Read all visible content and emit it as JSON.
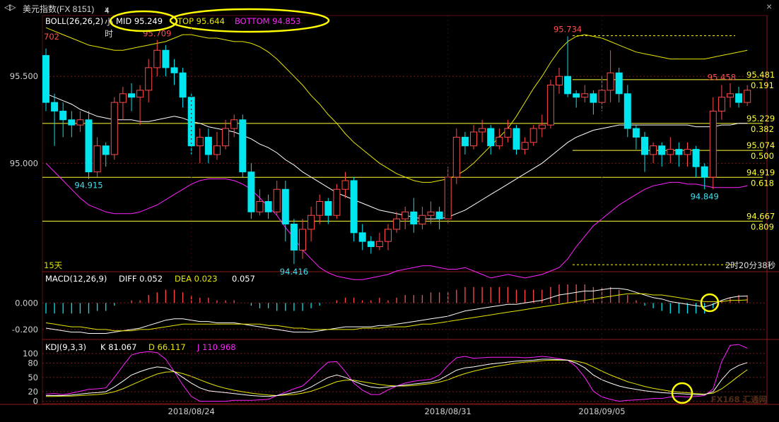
{
  "window": {
    "nav_icon": "back-forward-icon",
    "symbol": "美元指数(FX 8151)",
    "period": "4小时",
    "period_dropdown_icon": "chevron-down-icon"
  },
  "colors": {
    "up": "#ff4a4a",
    "down": "#00e5ee",
    "mid": "#ffffff",
    "top": "#e6e600",
    "bottom": "#ff22ff",
    "fib": "#ffff33",
    "grid": "#7a1a1a",
    "axis_text": "#d0d0d0",
    "highlight": "#ffff00"
  },
  "boll": {
    "label": "BOLL(26,26,2)",
    "mid_label": "MID 95.249",
    "top_label": "TOP 95.644",
    "bottom_label": "BOTTOM 94.853"
  },
  "main_chart": {
    "ylim": [
      94.38,
      95.85
    ],
    "y_ticks": [
      95.5,
      95.0
    ],
    "y_tick_labels": [
      "95.500",
      "95.000"
    ],
    "left_edge_label": "702",
    "period_label": "15天",
    "countdown": "2时20分38秒",
    "high_low_annotations": [
      {
        "text": "95.709",
        "index": 13,
        "value": 95.709,
        "kind": "high"
      },
      {
        "text": "94.915",
        "index": 5,
        "value": 94.915,
        "kind": "low"
      },
      {
        "text": "94.416",
        "index": 29,
        "value": 94.416,
        "kind": "low"
      },
      {
        "text": "95.734",
        "index": 61,
        "value": 95.734,
        "kind": "high"
      },
      {
        "text": "95.458",
        "index": 79,
        "value": 95.458,
        "kind": "high"
      },
      {
        "text": "94.849",
        "index": 77,
        "value": 94.849,
        "kind": "low"
      }
    ],
    "fib_levels": [
      {
        "price": 95.734,
        "label": "",
        "ratio": "",
        "dashed": true
      },
      {
        "price": 95.481,
        "label": "95.481",
        "ratio": "0.191",
        "dashed": false
      },
      {
        "price": 95.229,
        "label": "95.229",
        "ratio": "0.382",
        "dashed": false
      },
      {
        "price": 95.074,
        "label": "95.074",
        "ratio": "0.500",
        "dashed": false
      },
      {
        "price": 94.919,
        "label": "94.919",
        "ratio": "0.618",
        "dashed": false
      },
      {
        "price": 94.667,
        "label": "94.667",
        "ratio": "0.809",
        "dashed": false
      },
      {
        "price": 94.416,
        "label": "",
        "ratio": "",
        "dashed": true
      }
    ]
  },
  "macd": {
    "label": "MACD(12,26,9)",
    "diff_label": "DIFF 0.052",
    "dea_label": "DEA 0.023",
    "macd_value": "0.057",
    "ylim": [
      -0.27,
      0.22
    ],
    "y_ticks": [
      0.0,
      -0.2
    ],
    "y_tick_labels": [
      "0.000",
      "-0.200"
    ]
  },
  "kdj": {
    "label": "KDJ(9,3,3)",
    "k_label": "K 81.067",
    "d_label": "D 66.117",
    "j_label": "J 110.968",
    "ylim": [
      -5,
      125
    ],
    "y_ticks": [
      100,
      80,
      50,
      20,
      0
    ],
    "y_tick_labels": [
      "100",
      "80",
      "50",
      "20",
      "0"
    ]
  },
  "x_axis": {
    "labels": [
      {
        "text": "2018/08/24",
        "index": 17
      },
      {
        "text": "2018/08/31",
        "index": 47
      },
      {
        "text": "2018/09/05",
        "index": 65
      }
    ]
  },
  "watermark": "FX168 汇通网",
  "chart_data": {
    "type": "candlestick",
    "title": "美元指数(FX 8151)",
    "period": "4小时",
    "xlabel": "",
    "ylabel": "",
    "candles": [
      [
        95.62,
        95.35,
        95.66,
        95.3
      ],
      [
        95.35,
        95.3,
        95.4,
        95.1
      ],
      [
        95.3,
        95.25,
        95.35,
        95.15
      ],
      [
        95.25,
        95.22,
        95.3,
        95.15
      ],
      [
        95.22,
        95.25,
        95.3,
        95.18
      ],
      [
        95.25,
        94.95,
        95.3,
        94.91
      ],
      [
        94.95,
        95.1,
        95.15,
        94.92
      ],
      [
        95.1,
        95.05,
        95.12,
        94.98
      ],
      [
        95.05,
        95.35,
        95.38,
        95.02
      ],
      [
        95.35,
        95.4,
        95.44,
        95.25
      ],
      [
        95.4,
        95.38,
        95.46,
        95.3
      ],
      [
        95.38,
        95.42,
        95.45,
        95.22
      ],
      [
        95.42,
        95.55,
        95.6,
        95.35
      ],
      [
        95.55,
        95.65,
        95.71,
        95.5
      ],
      [
        95.65,
        95.55,
        95.68,
        95.5
      ],
      [
        95.55,
        95.52,
        95.6,
        95.45
      ],
      [
        95.52,
        95.38,
        95.55,
        95.32
      ],
      [
        95.38,
        95.1,
        95.4,
        95.05
      ],
      [
        95.1,
        95.15,
        95.2,
        95.0
      ],
      [
        95.15,
        95.05,
        95.2,
        95.0
      ],
      [
        95.05,
        95.1,
        95.18,
        95.02
      ],
      [
        95.1,
        95.2,
        95.25,
        95.08
      ],
      [
        95.2,
        95.25,
        95.28,
        95.15
      ],
      [
        95.25,
        94.95,
        95.28,
        94.92
      ],
      [
        94.95,
        94.72,
        95.0,
        94.68
      ],
      [
        94.72,
        94.78,
        94.85,
        94.7
      ],
      [
        94.78,
        94.72,
        94.82,
        94.68
      ],
      [
        94.72,
        94.85,
        94.9,
        94.7
      ],
      [
        94.85,
        94.65,
        94.9,
        94.55
      ],
      [
        94.65,
        94.5,
        94.68,
        94.42
      ],
      [
        94.5,
        94.62,
        94.68,
        94.45
      ],
      [
        94.62,
        94.7,
        94.75,
        94.55
      ],
      [
        94.7,
        94.78,
        94.82,
        94.65
      ],
      [
        94.78,
        94.7,
        94.8,
        94.65
      ],
      [
        94.7,
        94.85,
        94.88,
        94.68
      ],
      [
        94.85,
        94.9,
        94.95,
        94.8
      ],
      [
        94.9,
        94.6,
        94.92,
        94.55
      ],
      [
        94.6,
        94.55,
        94.65,
        94.5
      ],
      [
        94.55,
        94.52,
        94.58,
        94.48
      ],
      [
        94.52,
        94.55,
        94.6,
        94.5
      ],
      [
        94.55,
        94.62,
        94.65,
        94.5
      ],
      [
        94.62,
        94.68,
        94.72,
        94.6
      ],
      [
        94.68,
        94.72,
        94.75,
        94.62
      ],
      [
        94.72,
        94.65,
        94.8,
        94.6
      ],
      [
        94.65,
        94.7,
        94.75,
        94.62
      ],
      [
        94.7,
        94.72,
        94.78,
        94.65
      ],
      [
        94.72,
        94.68,
        94.75,
        94.62
      ],
      [
        94.68,
        94.92,
        94.98,
        94.65
      ],
      [
        94.92,
        95.15,
        95.2,
        94.88
      ],
      [
        95.15,
        95.1,
        95.18,
        95.05
      ],
      [
        95.1,
        95.18,
        95.22,
        95.08
      ],
      [
        95.18,
        95.2,
        95.25,
        95.12
      ],
      [
        95.2,
        95.1,
        95.22,
        95.05
      ],
      [
        95.1,
        95.15,
        95.2,
        95.08
      ],
      [
        95.15,
        95.2,
        95.25,
        95.12
      ],
      [
        95.2,
        95.08,
        95.22,
        95.05
      ],
      [
        95.08,
        95.12,
        95.15,
        95.05
      ],
      [
        95.12,
        95.2,
        95.22,
        95.1
      ],
      [
        95.2,
        95.22,
        95.28,
        95.15
      ],
      [
        95.22,
        95.45,
        95.48,
        95.2
      ],
      [
        95.45,
        95.5,
        95.55,
        95.4
      ],
      [
        95.5,
        95.4,
        95.73,
        95.38
      ],
      [
        95.4,
        95.38,
        95.42,
        95.32
      ],
      [
        95.38,
        95.4,
        95.45,
        95.35
      ],
      [
        95.4,
        95.35,
        95.42,
        95.28
      ],
      [
        95.35,
        95.42,
        95.5,
        95.3
      ],
      [
        95.42,
        95.52,
        95.65,
        95.35
      ],
      [
        95.52,
        95.4,
        95.55,
        95.35
      ],
      [
        95.4,
        95.2,
        95.45,
        95.15
      ],
      [
        95.2,
        95.15,
        95.22,
        95.08
      ],
      [
        95.15,
        95.05,
        95.18,
        94.95
      ],
      [
        95.05,
        95.1,
        95.12,
        95.0
      ],
      [
        95.1,
        95.05,
        95.12,
        94.98
      ],
      [
        95.05,
        95.08,
        95.15,
        95.0
      ],
      [
        95.08,
        95.05,
        95.12,
        94.98
      ],
      [
        95.05,
        95.08,
        95.12,
        94.98
      ],
      [
        95.08,
        94.98,
        95.1,
        94.92
      ],
      [
        94.98,
        94.92,
        95.0,
        94.85
      ],
      [
        94.92,
        95.3,
        95.38,
        94.85
      ],
      [
        95.3,
        95.38,
        95.45,
        95.25
      ],
      [
        95.38,
        95.4,
        95.46,
        95.32
      ],
      [
        95.4,
        95.35,
        95.44,
        95.32
      ],
      [
        95.35,
        95.42,
        95.45,
        95.33
      ]
    ],
    "boll_mid": [
      95.4,
      95.38,
      95.36,
      95.34,
      95.31,
      95.29,
      95.27,
      95.26,
      95.25,
      95.25,
      95.25,
      95.24,
      95.24,
      95.25,
      95.26,
      95.27,
      95.26,
      95.24,
      95.23,
      95.21,
      95.2,
      95.19,
      95.18,
      95.16,
      95.14,
      95.11,
      95.09,
      95.06,
      95.02,
      94.99,
      94.95,
      94.92,
      94.89,
      94.86,
      94.83,
      94.81,
      94.79,
      94.77,
      94.75,
      94.73,
      94.72,
      94.71,
      94.7,
      94.69,
      94.68,
      94.68,
      94.68,
      94.69,
      94.71,
      94.73,
      94.76,
      94.79,
      94.82,
      94.85,
      94.88,
      94.91,
      94.94,
      94.97,
      95.0,
      95.04,
      95.08,
      95.12,
      95.15,
      95.17,
      95.19,
      95.2,
      95.21,
      95.22,
      95.22,
      95.22,
      95.22,
      95.22,
      95.22,
      95.22,
      95.22,
      95.22,
      95.21,
      95.21,
      95.21,
      95.22,
      95.22,
      95.23,
      95.23
    ],
    "boll_top": [
      95.78,
      95.76,
      95.74,
      95.72,
      95.7,
      95.68,
      95.67,
      95.66,
      95.65,
      95.65,
      95.66,
      95.67,
      95.68,
      95.69,
      95.7,
      95.72,
      95.74,
      95.74,
      95.73,
      95.72,
      95.72,
      95.71,
      95.7,
      95.7,
      95.69,
      95.67,
      95.64,
      95.6,
      95.55,
      95.5,
      95.45,
      95.39,
      95.34,
      95.28,
      95.23,
      95.17,
      95.12,
      95.08,
      95.04,
      95.0,
      94.97,
      94.94,
      94.92,
      94.9,
      94.89,
      94.89,
      94.9,
      94.91,
      94.93,
      94.96,
      95.0,
      95.05,
      95.1,
      95.15,
      95.2,
      95.27,
      95.35,
      95.43,
      95.5,
      95.58,
      95.65,
      95.7,
      95.73,
      95.74,
      95.73,
      95.72,
      95.7,
      95.68,
      95.66,
      95.64,
      95.63,
      95.62,
      95.61,
      95.6,
      95.6,
      95.6,
      95.6,
      95.6,
      95.61,
      95.62,
      95.63,
      95.64,
      95.65
    ],
    "boll_bottom": [
      95.0,
      94.95,
      94.9,
      94.85,
      94.8,
      94.76,
      94.74,
      94.72,
      94.71,
      94.71,
      94.71,
      94.72,
      94.74,
      94.76,
      94.79,
      94.82,
      94.85,
      94.88,
      94.9,
      94.91,
      94.91,
      94.91,
      94.9,
      94.88,
      94.85,
      94.8,
      94.75,
      94.7,
      94.63,
      94.57,
      94.5,
      94.45,
      94.4,
      94.37,
      94.35,
      94.34,
      94.33,
      94.33,
      94.34,
      94.35,
      94.36,
      94.38,
      94.39,
      94.4,
      94.41,
      94.41,
      94.4,
      94.39,
      94.39,
      94.4,
      94.38,
      94.36,
      94.34,
      94.35,
      94.36,
      94.35,
      94.34,
      94.35,
      94.36,
      94.38,
      94.4,
      94.45,
      94.52,
      94.58,
      94.64,
      94.68,
      94.72,
      94.76,
      94.79,
      94.82,
      94.85,
      94.87,
      94.88,
      94.89,
      94.89,
      94.88,
      94.88,
      94.87,
      94.86,
      94.86,
      94.86,
      94.86,
      94.87
    ],
    "macd_diff": [
      -0.19,
      -0.2,
      -0.21,
      -0.22,
      -0.22,
      -0.23,
      -0.23,
      -0.23,
      -0.22,
      -0.21,
      -0.2,
      -0.19,
      -0.17,
      -0.15,
      -0.13,
      -0.12,
      -0.12,
      -0.13,
      -0.14,
      -0.14,
      -0.15,
      -0.15,
      -0.15,
      -0.16,
      -0.17,
      -0.18,
      -0.19,
      -0.2,
      -0.21,
      -0.22,
      -0.22,
      -0.22,
      -0.21,
      -0.2,
      -0.19,
      -0.18,
      -0.18,
      -0.18,
      -0.18,
      -0.17,
      -0.17,
      -0.16,
      -0.15,
      -0.14,
      -0.13,
      -0.12,
      -0.11,
      -0.1,
      -0.08,
      -0.06,
      -0.05,
      -0.04,
      -0.03,
      -0.02,
      -0.01,
      -0.01,
      0.0,
      0.01,
      0.02,
      0.04,
      0.06,
      0.07,
      0.08,
      0.09,
      0.09,
      0.1,
      0.11,
      0.11,
      0.1,
      0.08,
      0.06,
      0.04,
      0.03,
      0.01,
      0.0,
      -0.01,
      -0.02,
      -0.03,
      -0.01,
      0.02,
      0.04,
      0.05,
      0.052
    ],
    "macd_dea": [
      -0.15,
      -0.16,
      -0.17,
      -0.18,
      -0.18,
      -0.19,
      -0.2,
      -0.2,
      -0.21,
      -0.21,
      -0.21,
      -0.2,
      -0.2,
      -0.19,
      -0.18,
      -0.17,
      -0.16,
      -0.16,
      -0.16,
      -0.16,
      -0.16,
      -0.16,
      -0.16,
      -0.16,
      -0.16,
      -0.16,
      -0.17,
      -0.17,
      -0.18,
      -0.19,
      -0.19,
      -0.2,
      -0.2,
      -0.2,
      -0.2,
      -0.2,
      -0.2,
      -0.19,
      -0.19,
      -0.19,
      -0.18,
      -0.18,
      -0.18,
      -0.17,
      -0.16,
      -0.16,
      -0.15,
      -0.14,
      -0.13,
      -0.12,
      -0.11,
      -0.1,
      -0.09,
      -0.08,
      -0.07,
      -0.06,
      -0.05,
      -0.04,
      -0.03,
      -0.02,
      -0.01,
      0.0,
      0.01,
      0.02,
      0.03,
      0.04,
      0.05,
      0.06,
      0.07,
      0.07,
      0.07,
      0.06,
      0.06,
      0.05,
      0.04,
      0.03,
      0.02,
      0.01,
      0.01,
      0.01,
      0.02,
      0.02,
      0.023
    ],
    "kdj_k": [
      12,
      12,
      12,
      13,
      15,
      17,
      18,
      20,
      30,
      42,
      55,
      62,
      68,
      72,
      70,
      62,
      50,
      38,
      28,
      22,
      20,
      18,
      16,
      14,
      12,
      11,
      10,
      12,
      15,
      18,
      22,
      30,
      40,
      50,
      55,
      50,
      42,
      35,
      30,
      28,
      30,
      32,
      34,
      36,
      38,
      40,
      45,
      55,
      65,
      70,
      72,
      75,
      78,
      80,
      82,
      84,
      85,
      86,
      88,
      88,
      87,
      86,
      80,
      70,
      55,
      45,
      38,
      32,
      28,
      25,
      22,
      20,
      18,
      17,
      16,
      15,
      14,
      14,
      20,
      45,
      65,
      75,
      81
    ],
    "kdj_d": [
      10,
      10,
      11,
      11,
      12,
      13,
      14,
      16,
      20,
      26,
      34,
      42,
      50,
      57,
      61,
      62,
      58,
      52,
      45,
      38,
      32,
      27,
      23,
      20,
      17,
      15,
      13,
      12,
      13,
      14,
      17,
      21,
      27,
      34,
      41,
      44,
      44,
      41,
      38,
      35,
      33,
      32,
      32,
      33,
      35,
      37,
      40,
      45,
      52,
      58,
      63,
      67,
      71,
      74,
      77,
      80,
      82,
      83,
      85,
      86,
      86,
      86,
      84,
      80,
      72,
      63,
      55,
      48,
      41,
      36,
      31,
      27,
      24,
      21,
      19,
      18,
      16,
      15,
      17,
      26,
      39,
      53,
      66
    ],
    "kdj_j": [
      15,
      16,
      14,
      17,
      21,
      25,
      26,
      28,
      50,
      74,
      97,
      102,
      104,
      102,
      88,
      62,
      34,
      10,
      0,
      0,
      0,
      0,
      2,
      2,
      2,
      3,
      4,
      12,
      19,
      26,
      32,
      48,
      66,
      82,
      83,
      62,
      38,
      23,
      14,
      14,
      24,
      32,
      38,
      42,
      44,
      46,
      55,
      75,
      91,
      94,
      90,
      91,
      92,
      92,
      92,
      92,
      91,
      92,
      94,
      92,
      89,
      86,
      72,
      50,
      21,
      9,
      4,
      0,
      2,
      3,
      4,
      6,
      6,
      9,
      10,
      9,
      10,
      12,
      26,
      83,
      117,
      119,
      111
    ]
  }
}
